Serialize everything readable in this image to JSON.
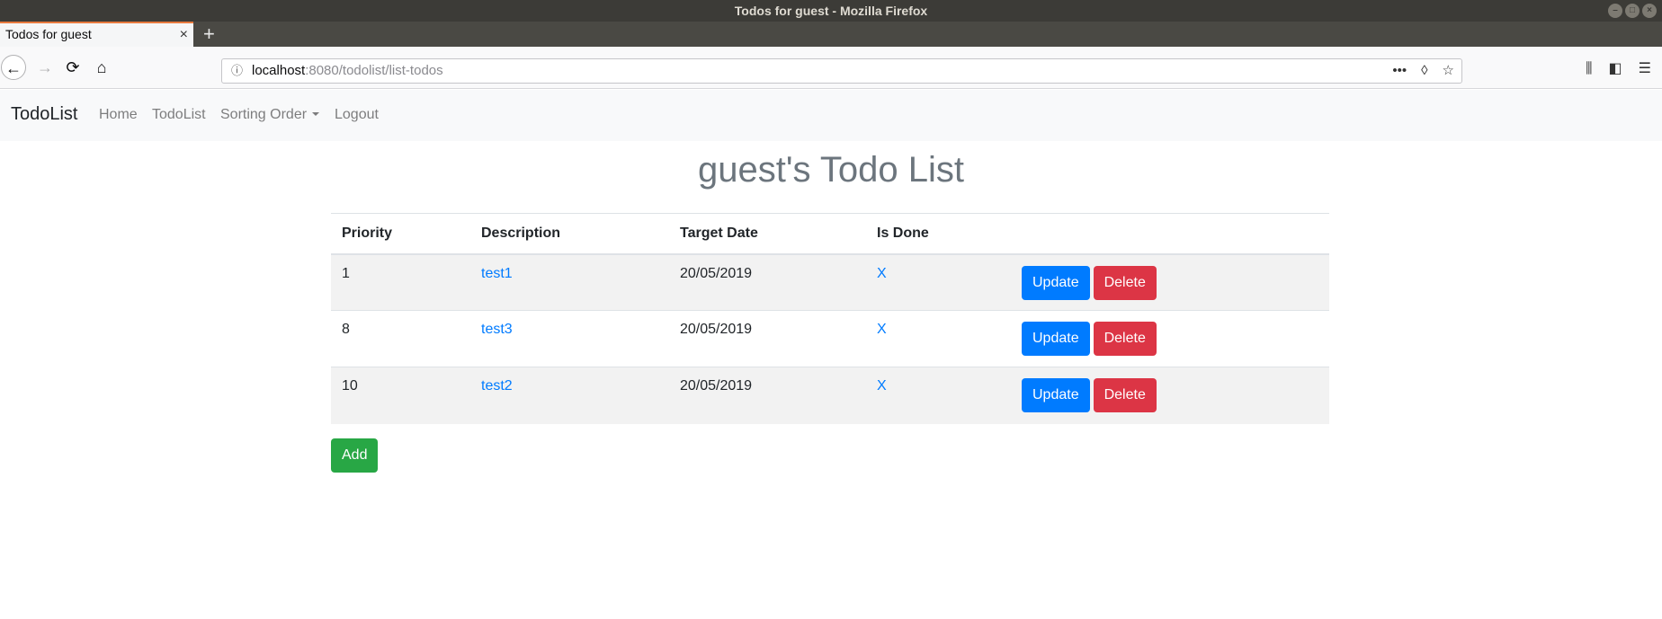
{
  "window": {
    "title": "Todos for guest - Mozilla Firefox",
    "controls": [
      "–",
      "□",
      "×"
    ]
  },
  "tab": {
    "label": "Todos for guest",
    "close": "×",
    "new_tab": "+"
  },
  "toolbar": {
    "back": "←",
    "forward": "→",
    "reload": "⟳",
    "home": "⌂",
    "url_info": "ⓘ",
    "url_host": "localhost",
    "url_rest": ":8080/todolist/list-todos",
    "url_more": "•••",
    "pocket": "◊",
    "bookmark": "☆",
    "library": "⫼",
    "sidebar": "◧",
    "menu": "☰"
  },
  "nav": {
    "brand": "TodoList",
    "links": [
      "Home",
      "TodoList",
      "Sorting Order",
      "Logout"
    ]
  },
  "page_title": "guest's Todo List",
  "table": {
    "headers": [
      "Priority",
      "Description",
      "Target Date",
      "Is Done",
      ""
    ],
    "rows": [
      {
        "priority": "1",
        "description": "test1",
        "target_date": "20/05/2019",
        "is_done": "X"
      },
      {
        "priority": "8",
        "description": "test3",
        "target_date": "20/05/2019",
        "is_done": "X"
      },
      {
        "priority": "10",
        "description": "test2",
        "target_date": "20/05/2019",
        "is_done": "X"
      }
    ],
    "update_label": "Update",
    "delete_label": "Delete"
  },
  "add_label": "Add",
  "colors": {
    "primary": "#007bff",
    "danger": "#dc3545",
    "success": "#28a745",
    "title_gray": "#6c757d"
  }
}
